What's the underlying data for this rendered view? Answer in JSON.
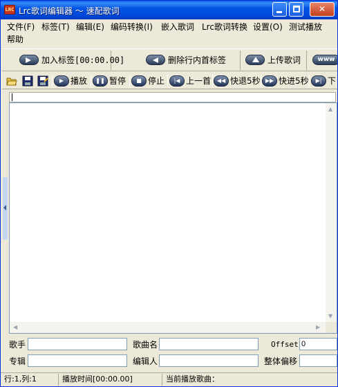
{
  "window": {
    "title": "Lrc歌词编辑器 ～ 速配歌词",
    "app_icon_text": "LRC"
  },
  "menu": [
    "文件(F)",
    "标签(T)",
    "编辑(E)",
    "编码转换(I)",
    "嵌入歌词",
    "Lrc歌词转换",
    "设置(O)",
    "测试播放",
    "帮助"
  ],
  "big_toolbar": {
    "add_tag": "加入标签[00:00.00]",
    "delete_tag": "删除行内首标签",
    "upload": "上传歌词",
    "www": "www"
  },
  "small_toolbar": {
    "play": "播放",
    "pause": "暂停",
    "stop": "停止",
    "prev": "上一首",
    "rewind": "快退5秒",
    "forward": "快进5秒",
    "next": "下"
  },
  "fields": {
    "artist_label": "歌手",
    "artist_value": "",
    "title_label": "歌曲名",
    "title_value": "",
    "offset_label": "Offset",
    "offset_value": "0",
    "album_label": "专辑",
    "album_value": "",
    "editor_label": "编辑人",
    "editor_value": "",
    "global_offset_label": "整体偏移",
    "global_offset_value": ""
  },
  "status": {
    "position": "行:1,列:1",
    "play_time": "播放时间[00:00.00]",
    "current_song": "当前播放歌曲："
  }
}
